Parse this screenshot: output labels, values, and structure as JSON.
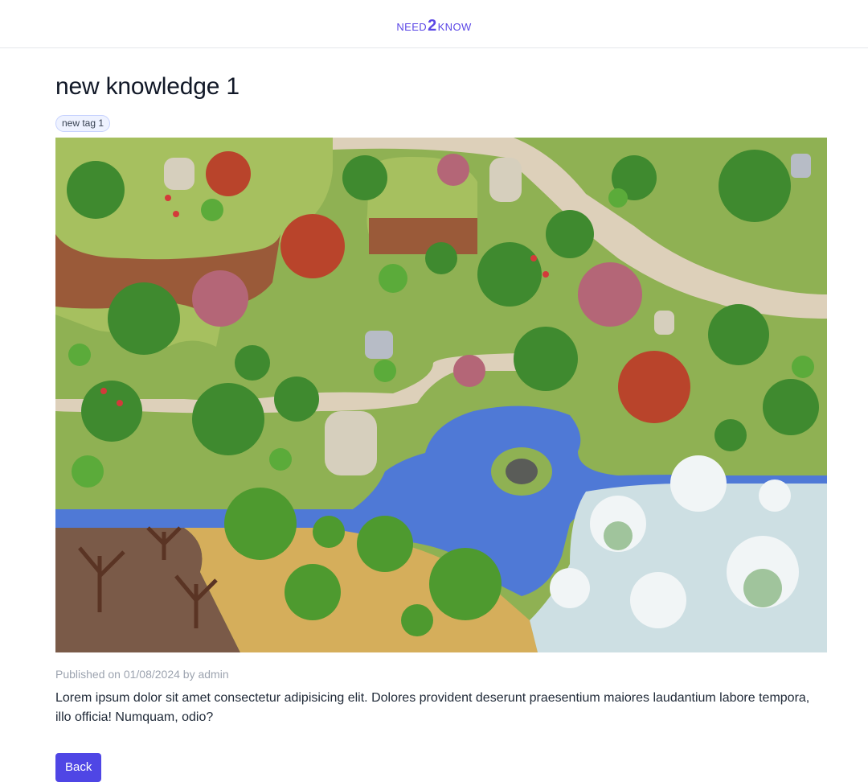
{
  "header": {
    "logo_left": "NEED",
    "logo_num": "2",
    "logo_right": "KNOW",
    "brand_color": "#5b47e6"
  },
  "article": {
    "title": "new knowledge 1",
    "tags": [
      "new tag 1"
    ],
    "image_alt": "pixel-art forest tileset illustration",
    "meta": "Published on 01/08/2024 by admin",
    "body": "Lorem ipsum dolor sit amet consectetur adipisicing elit. Dolores provident deserunt praesentium maiores laudantium labore tempora, illo officia! Numquam, odio?",
    "back_label": "Back"
  },
  "colors": {
    "accent": "#4f46e5",
    "tag_bg": "#eef2ff",
    "muted_text": "#9ca3af"
  }
}
